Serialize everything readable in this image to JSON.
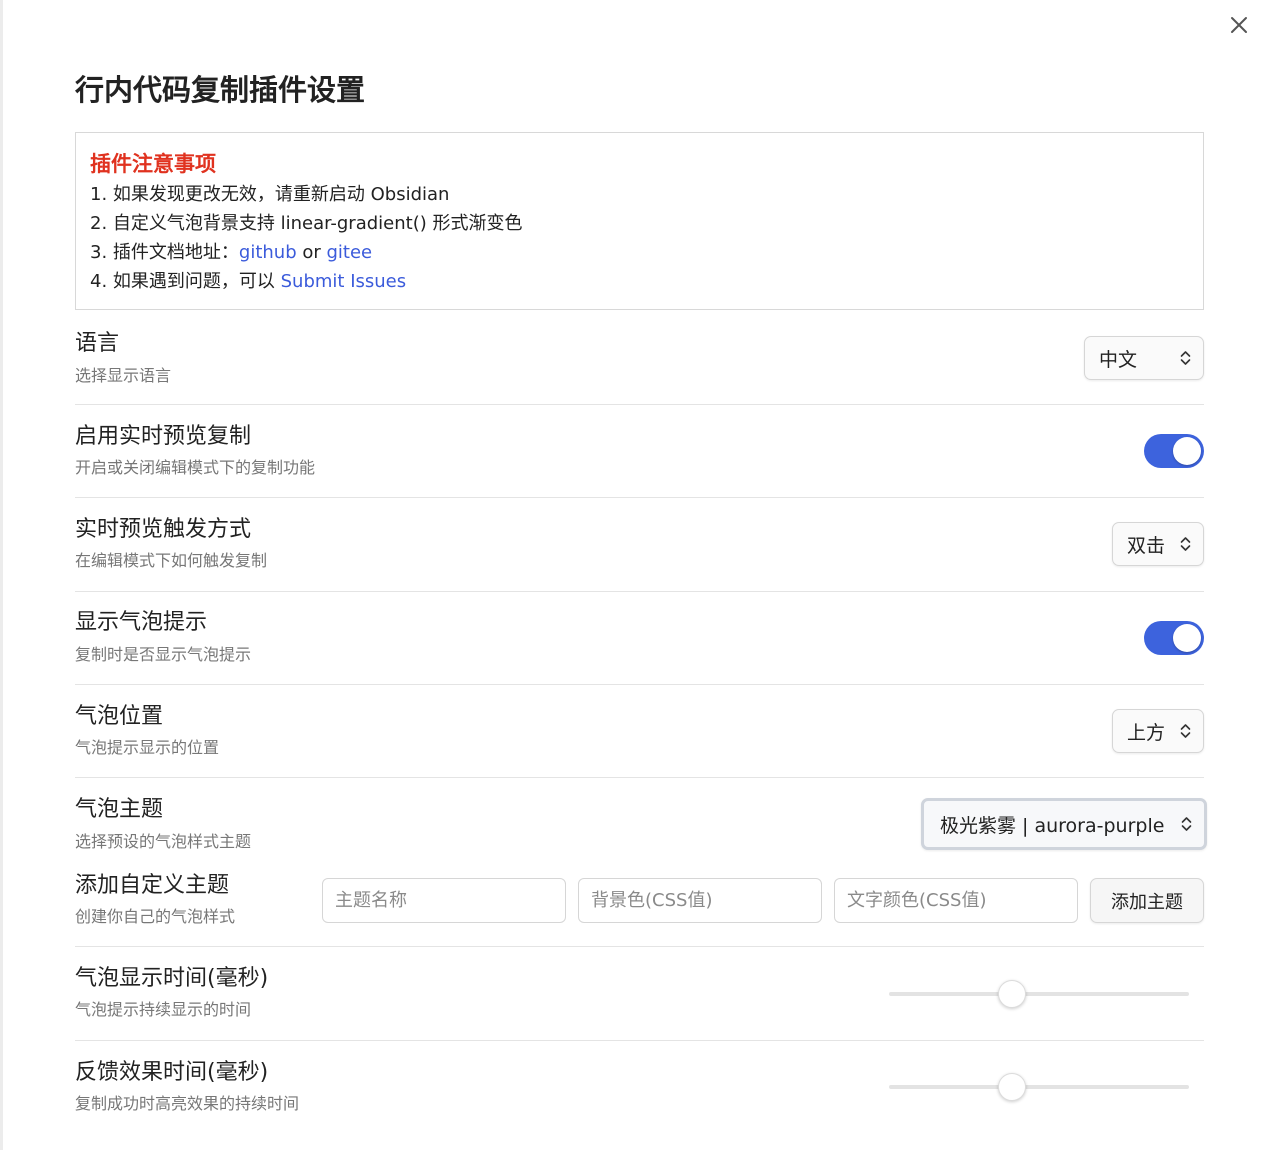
{
  "title": "行内代码复制插件设置",
  "notice": {
    "title": "插件注意事项",
    "line1": "1. 如果发现更改无效，请重新启动 Obsidian",
    "line2": "2. 自定义气泡背景支持 linear-gradient() 形式渐变色",
    "line3_prefix": "3. 插件文档地址：",
    "line3_link1": "github",
    "line3_mid": " or ",
    "line3_link2": "gitee",
    "line4_prefix": "4. 如果遇到问题，可以 ",
    "line4_link": "Submit Issues"
  },
  "settings": {
    "language": {
      "name": "语言",
      "desc": "选择显示语言",
      "value": "中文"
    },
    "live_preview": {
      "name": "启用实时预览复制",
      "desc": "开启或关闭编辑模式下的复制功能",
      "enabled": true
    },
    "trigger": {
      "name": "实时预览触发方式",
      "desc": "在编辑模式下如何触发复制",
      "value": "双击"
    },
    "show_bubble": {
      "name": "显示气泡提示",
      "desc": "复制时是否显示气泡提示",
      "enabled": true
    },
    "bubble_position": {
      "name": "气泡位置",
      "desc": "气泡提示显示的位置",
      "value": "上方"
    },
    "bubble_theme": {
      "name": "气泡主题",
      "desc": "选择预设的气泡样式主题",
      "value": "极光紫雾 | aurora-purple"
    },
    "custom_theme": {
      "name": "添加自定义主题",
      "desc": "创建你自己的气泡样式",
      "name_placeholder": "主题名称",
      "bg_placeholder": "背景色(CSS值)",
      "text_placeholder": "文字颜色(CSS值)",
      "button_label": "添加主题"
    },
    "bubble_duration": {
      "name": "气泡显示时间(毫秒)",
      "desc": "气泡提示持续显示的时间",
      "fraction": 0.41
    },
    "feedback_duration": {
      "name": "反馈效果时间(毫秒)",
      "desc": "复制成功时高亮效果的持续时间",
      "fraction": 0.41
    }
  },
  "colors": {
    "accent": "#3d63dd",
    "notice_title": "#e0321f",
    "link": "#3b5bdb"
  }
}
